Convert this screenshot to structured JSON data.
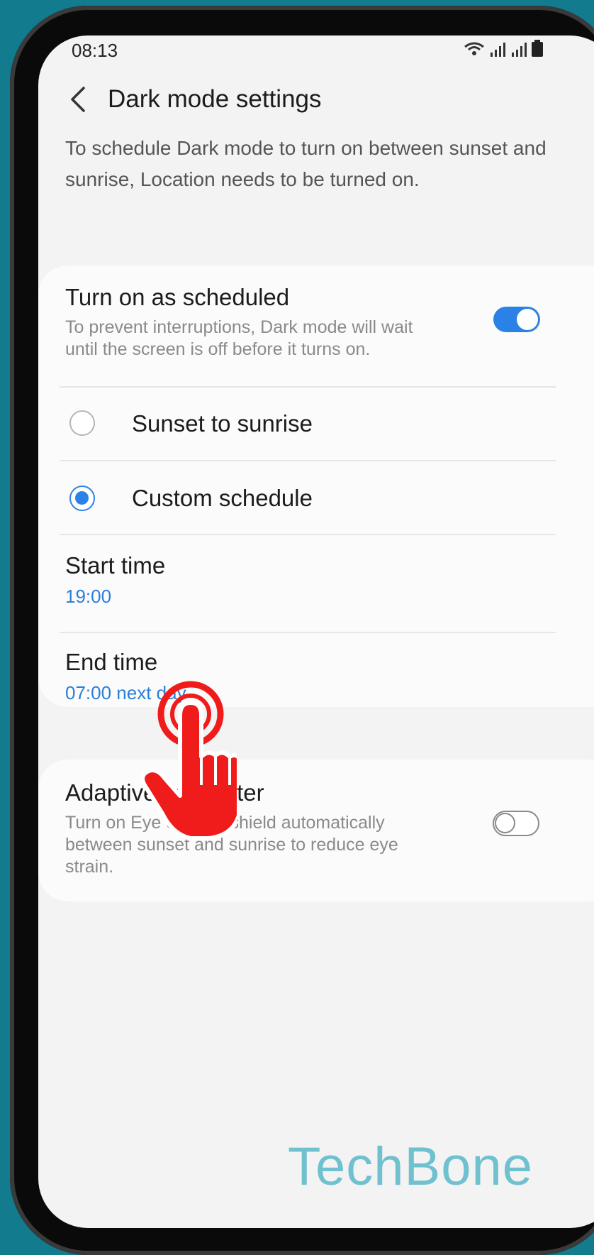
{
  "status_bar": {
    "time": "08:13"
  },
  "header": {
    "title": "Dark mode settings"
  },
  "description": "To schedule Dark mode to turn on between sunset and sunrise, Location needs to be turned on.",
  "schedule_card": {
    "turn_on": {
      "title": "Turn on as scheduled",
      "subtitle": "To prevent interruptions, Dark mode will wait until the screen is off before it turns on.",
      "enabled": true
    },
    "options": [
      {
        "label": "Sunset to sunrise",
        "selected": false
      },
      {
        "label": "Custom schedule",
        "selected": true
      }
    ],
    "start_time": {
      "title": "Start time",
      "value": "19:00"
    },
    "end_time": {
      "title": "End time",
      "value": "07:00 next day"
    }
  },
  "filter_card": {
    "title": "Adaptive color filter",
    "subtitle": "Turn on Eye comfort shield automatically between sunset and sunrise to reduce eye strain.",
    "enabled": false
  },
  "watermark": "TechBone",
  "colors": {
    "accent": "#2b82e6",
    "value_text": "#2b7fd6",
    "background": "#127b8e",
    "hand": "#f01c1c"
  },
  "icons": {
    "back": "chevron-left-icon",
    "wifi": "wifi-icon",
    "signal": "signal-icon",
    "battery": "battery-icon",
    "tap": "tap-hand-icon"
  }
}
